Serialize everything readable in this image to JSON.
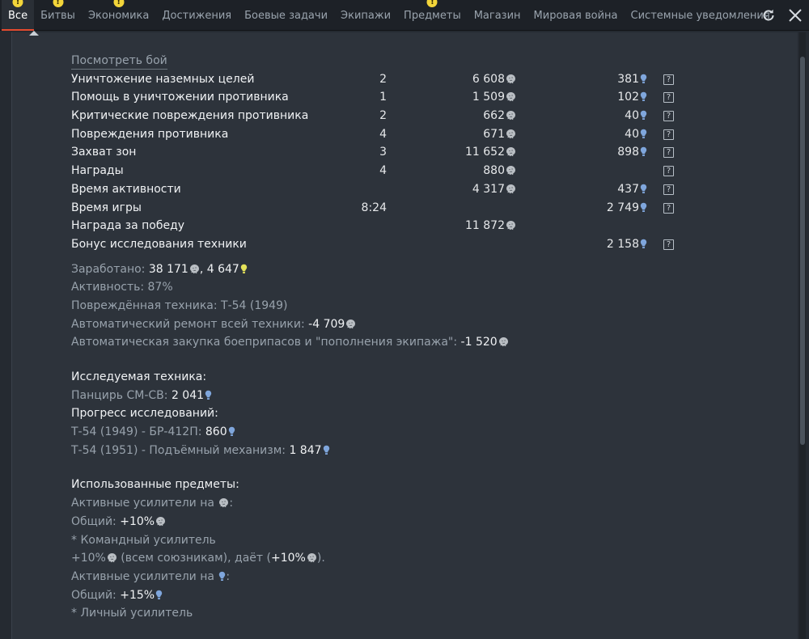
{
  "tabs": [
    {
      "label": "Все",
      "active": true,
      "badge": true
    },
    {
      "label": "Битвы",
      "active": false,
      "badge": true
    },
    {
      "label": "Экономика",
      "active": false,
      "badge": true
    },
    {
      "label": "Достижения",
      "active": false,
      "badge": false
    },
    {
      "label": "Боевые задачи",
      "active": false,
      "badge": false
    },
    {
      "label": "Экипажи",
      "active": false,
      "badge": false
    },
    {
      "label": "Предметы",
      "active": false,
      "badge": true
    },
    {
      "label": "Магазин",
      "active": false,
      "badge": false
    },
    {
      "label": "Мировая война",
      "active": false,
      "badge": false
    },
    {
      "label": "Системные уведомления",
      "active": false,
      "badge": false
    }
  ],
  "badge_symbol": "!",
  "view_battle_link": "Посмотреть бой",
  "rows": [
    {
      "label": "Уничтожение наземных целей",
      "count": "2",
      "sl": "6 608",
      "rp": "381"
    },
    {
      "label": "Помощь в уничтожении противника",
      "count": "1",
      "sl": "1 509",
      "rp": "102"
    },
    {
      "label": "Критические повреждения противника",
      "count": "2",
      "sl": "662",
      "rp": "40"
    },
    {
      "label": "Повреждения противника",
      "count": "4",
      "sl": "671",
      "rp": "40"
    },
    {
      "label": "Захват зон",
      "count": "3",
      "sl": "11 652",
      "rp": "898"
    },
    {
      "label": "Награды",
      "count": "4",
      "sl": "880",
      "rp": ""
    },
    {
      "label": "Время активности",
      "count": "",
      "sl": "4 317",
      "rp": "437"
    },
    {
      "label": "Время игры",
      "count": "8:24",
      "sl": "",
      "rp": "2 749"
    },
    {
      "label": "Награда за победу",
      "count": "",
      "sl": "11 872",
      "rp": "",
      "no_help": true
    },
    {
      "label": "Бонус исследования техники",
      "count": "",
      "sl": "",
      "rp": "2 158"
    }
  ],
  "help_symbol": "?",
  "summary": {
    "earned_label": "Заработано: ",
    "earned_sl": "38 171",
    "earned_sep": ", ",
    "earned_rp": "4 647",
    "activity": "Активность: 87%",
    "damaged": "Повреждённая техника: Т-54 (1949)",
    "repair_label": "Автоматический ремонт всей техники: ",
    "repair_value": "-4 709",
    "purchase_label": "Автоматическая закупка боеприпасов и \"пополнения экипажа\": ",
    "purchase_value": "-1 520"
  },
  "research": {
    "title": "Исследуемая техника:",
    "item_label": "Панцирь СМ-СВ: ",
    "item_value": "2 041",
    "progress_title": "Прогресс исследований:",
    "p1_label": "Т-54 (1949) - БР-412П: ",
    "p1_value": "860",
    "p2_label": "Т-54 (1951) - Подъёмный механизм: ",
    "p2_value": "1 847"
  },
  "items": {
    "title": "Использованные предметы:",
    "active_sl": "Активные усилители на ",
    "colon": ":",
    "general_label": "Общий: ",
    "general_sl_value": "+10%",
    "commander": "* Командный усилитель",
    "team_value": "+10%",
    "team_text": " (всем союзникам), даёт (",
    "team_gives": "+10%",
    "team_end": ").",
    "active_rp": "Активные усилители на ",
    "general_rp_value": "+15%",
    "personal": "* Личный усилитель"
  },
  "colors": {
    "accent": "#e44a2e",
    "badge": "#f3d53a",
    "rp_icon": "#7fa6dc",
    "earned_rp_icon": "#e4e25a"
  },
  "icons": {
    "sl": "silver-lions-icon",
    "rp": "research-points-icon",
    "refresh": "refresh-icon",
    "close": "close-icon"
  }
}
